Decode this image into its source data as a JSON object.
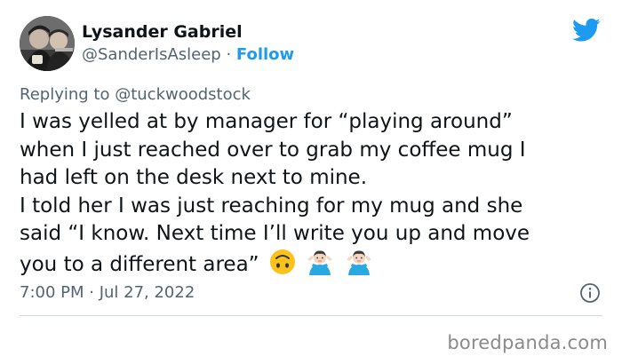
{
  "author": {
    "display_name": "Lysander Gabriel",
    "handle": "@SanderIsAsleep",
    "separator": " · ",
    "follow_label": "Follow"
  },
  "reply": {
    "prefix": "Replying to ",
    "handle": "@tuckwoodstock"
  },
  "tweet": {
    "lines": [
      "I was yelled at by manager for “playing around”",
      "when I just reached over to grab my coffee mug I",
      "had left on the desk next to mine.",
      "I told her I was just reaching for my mug and she",
      "said “I know. Next time I’ll write you up and move",
      "you to a different area”"
    ],
    "emojis": [
      "upside-down-face",
      "person-shrugging",
      "person-shrugging"
    ]
  },
  "meta": {
    "timestamp": "7:00 PM · Jul 27, 2022"
  },
  "colors": {
    "accent": "#1d9bf0",
    "text": "#0f1419",
    "muted": "#536471"
  },
  "icons": [
    "twitter-bird-icon",
    "info-icon"
  ],
  "watermark": "boredpanda.com"
}
